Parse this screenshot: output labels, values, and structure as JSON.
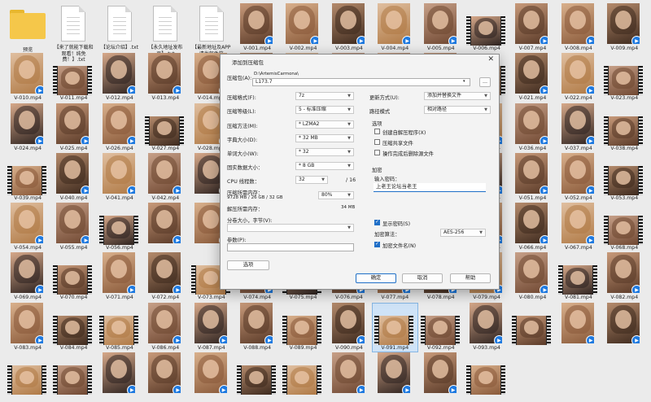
{
  "folder": {
    "label": "预览"
  },
  "docs": [
    "【来了就能下载和观看！纯免费！】.txt",
    "【论坛介绍】.txt",
    "【永久地址发布页】.txt",
    "【最新地址及APP请发邮件获取！！！】"
  ],
  "videos": [
    "V-001.mp4",
    "V-002.mp4",
    "V-003.mp4",
    "V-004.mp4",
    "V-005.mp4",
    "V-006.mp4",
    "V-007.mp4",
    "V-008.mp4",
    "V-009.mp4",
    "V-010.mp4",
    "V-011.mp4",
    "V-012.mp4",
    "V-013.mp4",
    "V-014.mp4",
    "",
    "",
    "",
    "",
    "",
    "",
    "V-021.mp4",
    "V-022.mp4",
    "V-023.mp4",
    "V-024.mp4",
    "V-025.mp4",
    "V-026.mp4",
    "V-027.mp4",
    "V-028.mp4",
    "",
    "",
    "",
    "",
    "",
    "V-035.mp4",
    "V-036.mp4",
    "V-037.mp4",
    "V-038.mp4",
    "V-039.mp4",
    "V-040.mp4",
    "V-041.mp4",
    "V-042.mp4",
    "",
    "",
    "",
    "",
    "",
    "V-049.mp4",
    "V-050.mp4",
    "V-051.mp4",
    "V-052.mp4",
    "V-053.mp4",
    "V-054.mp4",
    "V-055.mp4",
    "V-056.mp4",
    "",
    "",
    "",
    "",
    "",
    "V-063.mp4",
    "V-064.mp4",
    "V-065.mp4",
    "V-066.mp4",
    "V-067.mp4",
    "V-068.mp4",
    "V-069.mp4",
    "V-070.mp4",
    "V-071.mp4",
    "V-072.mp4",
    "V-073.mp4",
    "V-074.mp4",
    "V-075.mp4",
    "V-076.mp4",
    "V-077.mp4",
    "V-078.mp4",
    "V-079.mp4",
    "V-080.mp4",
    "V-081.mp4",
    "V-082.mp4",
    "V-083.mp4",
    "V-084.mp4",
    "V-085.mp4",
    "V-086.mp4",
    "V-087.mp4",
    "V-088.mp4",
    "V-089.mp4",
    "V-090.mp4",
    "V-091.mp4",
    "V-092.mp4",
    "V-093.mp4",
    "",
    "",
    "",
    "",
    "",
    "",
    "",
    "",
    "",
    "",
    "",
    "",
    "",
    ""
  ],
  "film_indices": [
    5,
    10,
    19,
    22,
    26,
    36,
    37,
    50,
    53,
    60,
    64,
    66,
    69,
    71,
    77,
    80,
    81,
    85,
    87,
    88,
    90,
    93,
    94,
    98,
    99,
    103,
    104,
    107,
    110,
    111,
    114,
    116,
    117,
    118,
    120,
    124
  ],
  "selected_video": "V-091.mp4",
  "dialog": {
    "title": "添加到压缩包",
    "close": "✕",
    "archive_label": "压缩包(A):",
    "archive_path": "D:\\ArtemisCarmona\\",
    "archive_name": "L173.7",
    "browse": "...",
    "format_label": "压缩格式(F):",
    "format_value": "7z",
    "level_label": "压缩等级(L):",
    "level_value": "5 - 标准压缩",
    "method_label": "压缩方法(M):",
    "method_value": "* LZMA2",
    "dict_label": "字典大小(D):",
    "dict_value": "* 32 MB",
    "word_label": "单词大小(W):",
    "word_value": "* 32",
    "solid_label": "固实数据大小：",
    "solid_value": "* 8 GB",
    "threads_label": "CPU 线程数：",
    "threads_value": "32",
    "threads_max": "/ 16",
    "mem_comp_label": "压缩所需内存：",
    "mem_comp_value": "9728 MB / 26 GB / 32 GB",
    "mem_pct": "80%",
    "mem_decomp_label": "解压所需内存：",
    "mem_decomp_value": "34 MB",
    "split_label": "分卷大小，字节(V):",
    "params_label": "参数(P):",
    "options_btn": "选项",
    "update_label": "更新方式(U):",
    "update_value": "添加并替换文件",
    "path_label": "路径模式",
    "path_value": "相对路径",
    "opts_header": "选项",
    "opt_sfx": "创建自解压程序(X)",
    "opt_shared": "压缩共享文件",
    "opt_delete": "操作完成后删除源文件",
    "enc_header": "加密",
    "pw_label": "输入密码：",
    "pw_value": "上老王论坛当老王",
    "show_pw": "显示密码(S)",
    "enc_method_label": "加密算法：",
    "enc_method_value": "AES-256",
    "enc_names": "加密文件名(N)",
    "ok": "确定",
    "cancel": "取消",
    "help": "帮助"
  },
  "colors": {
    "accent": "#1f6fc7",
    "folder": "#f5c74a",
    "selected": "#cfe3f7"
  }
}
